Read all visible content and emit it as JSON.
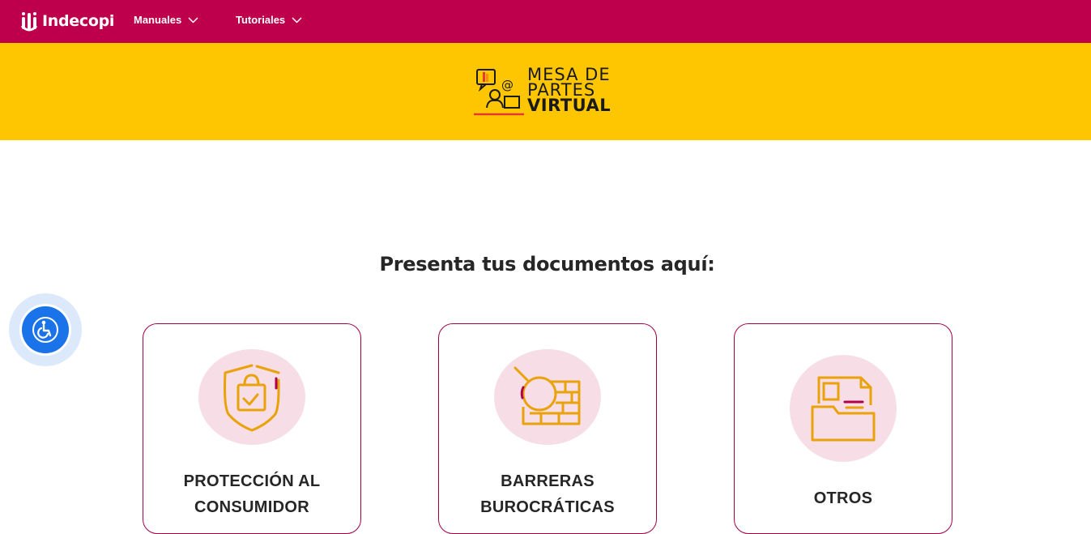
{
  "header": {
    "brand": "Indecopi",
    "nav": [
      {
        "label": "Manuales"
      },
      {
        "label": "Tutoriales"
      }
    ]
  },
  "banner": {
    "line1": "MESA DE",
    "line2": "PARTES",
    "line3": "VIRTUAL"
  },
  "main": {
    "heading": "Presenta tus documentos aquí:",
    "cards": [
      {
        "title_line1": "PROTECCIÓN AL",
        "title_line2": "CONSUMIDOR",
        "icon": "shield-shopping-bag-icon"
      },
      {
        "title_line1": "BARRERAS",
        "title_line2": "BUROCRÁTICAS",
        "icon": "magnifier-wall-icon"
      },
      {
        "title_line1": "OTROS",
        "title_line2": "",
        "icon": "document-folder-icon"
      }
    ]
  },
  "colors": {
    "header_bg": "#be004c",
    "banner_bg": "#fec601",
    "card_border": "#a3004a",
    "icon_circle": "#f6dde6",
    "icon_stroke": "#e9a20a",
    "accessibility_blue": "#1a73e8"
  },
  "accessibility": {
    "icon": "wheelchair-icon"
  }
}
